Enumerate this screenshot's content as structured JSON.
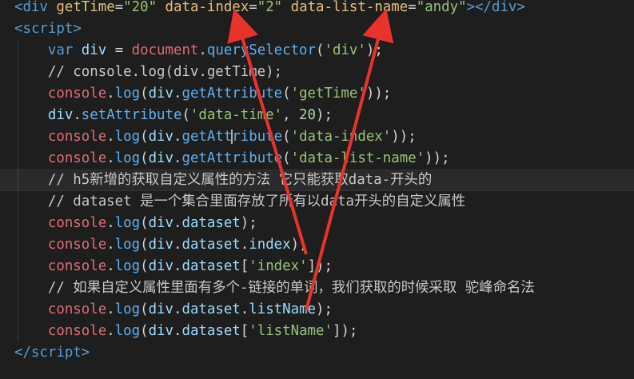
{
  "editor": {
    "lines": [
      {
        "tokens": [
          {
            "t": "<",
            "c": "tag"
          },
          {
            "t": "div",
            "c": "tag"
          },
          {
            "t": " ",
            "c": "plain"
          },
          {
            "t": "getTime",
            "c": "attr-y"
          },
          {
            "t": "=",
            "c": "plain"
          },
          {
            "t": "\"20\"",
            "c": "str-g"
          },
          {
            "t": " ",
            "c": "plain"
          },
          {
            "t": "data-index",
            "c": "attr-y"
          },
          {
            "t": "=",
            "c": "plain"
          },
          {
            "t": "\"2\"",
            "c": "str-g"
          },
          {
            "t": " ",
            "c": "plain"
          },
          {
            "t": "data-list-name",
            "c": "attr-y"
          },
          {
            "t": "=",
            "c": "plain"
          },
          {
            "t": "\"andy\"",
            "c": "str-g"
          },
          {
            "t": "></",
            "c": "tag"
          },
          {
            "t": "div",
            "c": "tag"
          },
          {
            "t": ">",
            "c": "tag"
          }
        ]
      },
      {
        "tokens": [
          {
            "t": "<",
            "c": "tag"
          },
          {
            "t": "script",
            "c": "tag"
          },
          {
            "t": ">",
            "c": "tag"
          }
        ]
      },
      {
        "tokens": [
          {
            "t": "    ",
            "c": "plain"
          },
          {
            "t": "var",
            "c": "kw"
          },
          {
            "t": " ",
            "c": "plain"
          },
          {
            "t": "div",
            "c": "var"
          },
          {
            "t": " = ",
            "c": "plain"
          },
          {
            "t": "document",
            "c": "obj"
          },
          {
            "t": ".",
            "c": "plain"
          },
          {
            "t": "querySelector",
            "c": "fn"
          },
          {
            "t": "(",
            "c": "plain"
          },
          {
            "t": "'div'",
            "c": "str-g"
          },
          {
            "t": ");",
            "c": "plain"
          }
        ]
      },
      {
        "tokens": [
          {
            "t": "    ",
            "c": "plain"
          },
          {
            "t": "// console.log(div.getTime);",
            "c": "comment-w"
          }
        ]
      },
      {
        "tokens": [
          {
            "t": "    ",
            "c": "plain"
          },
          {
            "t": "console",
            "c": "obj"
          },
          {
            "t": ".",
            "c": "plain"
          },
          {
            "t": "log",
            "c": "fn"
          },
          {
            "t": "(",
            "c": "plain"
          },
          {
            "t": "div",
            "c": "var"
          },
          {
            "t": ".",
            "c": "plain"
          },
          {
            "t": "getAttribute",
            "c": "fn"
          },
          {
            "t": "(",
            "c": "plain"
          },
          {
            "t": "'getTime'",
            "c": "str-g"
          },
          {
            "t": "));",
            "c": "plain"
          }
        ]
      },
      {
        "tokens": [
          {
            "t": "    ",
            "c": "plain"
          },
          {
            "t": "div",
            "c": "var"
          },
          {
            "t": ".",
            "c": "plain"
          },
          {
            "t": "setAttribute",
            "c": "fn"
          },
          {
            "t": "(",
            "c": "plain"
          },
          {
            "t": "'data-time'",
            "c": "str-g"
          },
          {
            "t": ", ",
            "c": "plain"
          },
          {
            "t": "20",
            "c": "num"
          },
          {
            "t": ");",
            "c": "plain"
          }
        ]
      },
      {
        "tokens": [
          {
            "t": "    ",
            "c": "plain"
          },
          {
            "t": "console",
            "c": "obj"
          },
          {
            "t": ".",
            "c": "plain"
          },
          {
            "t": "log",
            "c": "fn"
          },
          {
            "t": "(",
            "c": "plain"
          },
          {
            "t": "div",
            "c": "var"
          },
          {
            "t": ".",
            "c": "plain"
          },
          {
            "t": "getAttribute",
            "c": "fn"
          },
          {
            "t": "(",
            "c": "plain"
          },
          {
            "t": "'data-index'",
            "c": "str-g"
          },
          {
            "t": "));",
            "c": "plain"
          }
        ]
      },
      {
        "tokens": [
          {
            "t": "    ",
            "c": "plain"
          },
          {
            "t": "console",
            "c": "obj"
          },
          {
            "t": ".",
            "c": "plain"
          },
          {
            "t": "log",
            "c": "fn"
          },
          {
            "t": "(",
            "c": "plain"
          },
          {
            "t": "div",
            "c": "var"
          },
          {
            "t": ".",
            "c": "plain"
          },
          {
            "t": "getAttribute",
            "c": "fn"
          },
          {
            "t": "(",
            "c": "plain"
          },
          {
            "t": "'data-list-name'",
            "c": "str-g"
          },
          {
            "t": "));",
            "c": "plain"
          }
        ]
      },
      {
        "active": true,
        "tokens": [
          {
            "t": "    ",
            "c": "plain"
          },
          {
            "t": "// h5新增的获取自定义属性的方法 它只能获取data-开头的",
            "c": "comment-w"
          }
        ]
      },
      {
        "tokens": [
          {
            "t": "    ",
            "c": "plain"
          },
          {
            "t": "// dataset 是一个集合里面存放了所有以data开头的自定义属性",
            "c": "comment-w"
          }
        ]
      },
      {
        "tokens": [
          {
            "t": "    ",
            "c": "plain"
          },
          {
            "t": "console",
            "c": "obj"
          },
          {
            "t": ".",
            "c": "plain"
          },
          {
            "t": "log",
            "c": "fn"
          },
          {
            "t": "(",
            "c": "plain"
          },
          {
            "t": "div",
            "c": "var"
          },
          {
            "t": ".",
            "c": "plain"
          },
          {
            "t": "dataset",
            "c": "prop"
          },
          {
            "t": ");",
            "c": "plain"
          }
        ]
      },
      {
        "tokens": [
          {
            "t": "    ",
            "c": "plain"
          },
          {
            "t": "console",
            "c": "obj"
          },
          {
            "t": ".",
            "c": "plain"
          },
          {
            "t": "log",
            "c": "fn"
          },
          {
            "t": "(",
            "c": "plain"
          },
          {
            "t": "div",
            "c": "var"
          },
          {
            "t": ".",
            "c": "plain"
          },
          {
            "t": "dataset",
            "c": "prop"
          },
          {
            "t": ".",
            "c": "plain"
          },
          {
            "t": "index",
            "c": "prop"
          },
          {
            "t": ");",
            "c": "plain"
          }
        ]
      },
      {
        "tokens": [
          {
            "t": "    ",
            "c": "plain"
          },
          {
            "t": "console",
            "c": "obj"
          },
          {
            "t": ".",
            "c": "plain"
          },
          {
            "t": "log",
            "c": "fn"
          },
          {
            "t": "(",
            "c": "plain"
          },
          {
            "t": "div",
            "c": "var"
          },
          {
            "t": ".",
            "c": "plain"
          },
          {
            "t": "dataset",
            "c": "prop"
          },
          {
            "t": "[",
            "c": "plain"
          },
          {
            "t": "'index'",
            "c": "str-g"
          },
          {
            "t": "]);",
            "c": "plain"
          }
        ]
      },
      {
        "tokens": [
          {
            "t": "    ",
            "c": "plain"
          },
          {
            "t": "// 如果自定义属性里面有多个-链接的单词，我们获取的时候采取 驼峰命名法",
            "c": "comment-w"
          }
        ]
      },
      {
        "tokens": [
          {
            "t": "    ",
            "c": "plain"
          },
          {
            "t": "console",
            "c": "obj"
          },
          {
            "t": ".",
            "c": "plain"
          },
          {
            "t": "log",
            "c": "fn"
          },
          {
            "t": "(",
            "c": "plain"
          },
          {
            "t": "div",
            "c": "var"
          },
          {
            "t": ".",
            "c": "plain"
          },
          {
            "t": "dataset",
            "c": "prop"
          },
          {
            "t": ".",
            "c": "plain"
          },
          {
            "t": "listName",
            "c": "prop"
          },
          {
            "t": ");",
            "c": "plain"
          }
        ]
      },
      {
        "tokens": [
          {
            "t": "    ",
            "c": "plain"
          },
          {
            "t": "console",
            "c": "obj"
          },
          {
            "t": ".",
            "c": "plain"
          },
          {
            "t": "log",
            "c": "fn"
          },
          {
            "t": "(",
            "c": "plain"
          },
          {
            "t": "div",
            "c": "var"
          },
          {
            "t": ".",
            "c": "plain"
          },
          {
            "t": "dataset",
            "c": "prop"
          },
          {
            "t": "[",
            "c": "plain"
          },
          {
            "t": "'listName'",
            "c": "str-g"
          },
          {
            "t": "]);",
            "c": "plain"
          }
        ]
      },
      {
        "tokens": [
          {
            "t": "</",
            "c": "tag"
          },
          {
            "t": "script",
            "c": "tag"
          },
          {
            "t": ">",
            "c": "tag"
          }
        ]
      }
    ]
  },
  "colors": {
    "background": "#1e1e1e",
    "annotation_arrow": "#e8322b"
  },
  "annotations": [
    "red-arrow-index",
    "red-arrow-listname"
  ]
}
